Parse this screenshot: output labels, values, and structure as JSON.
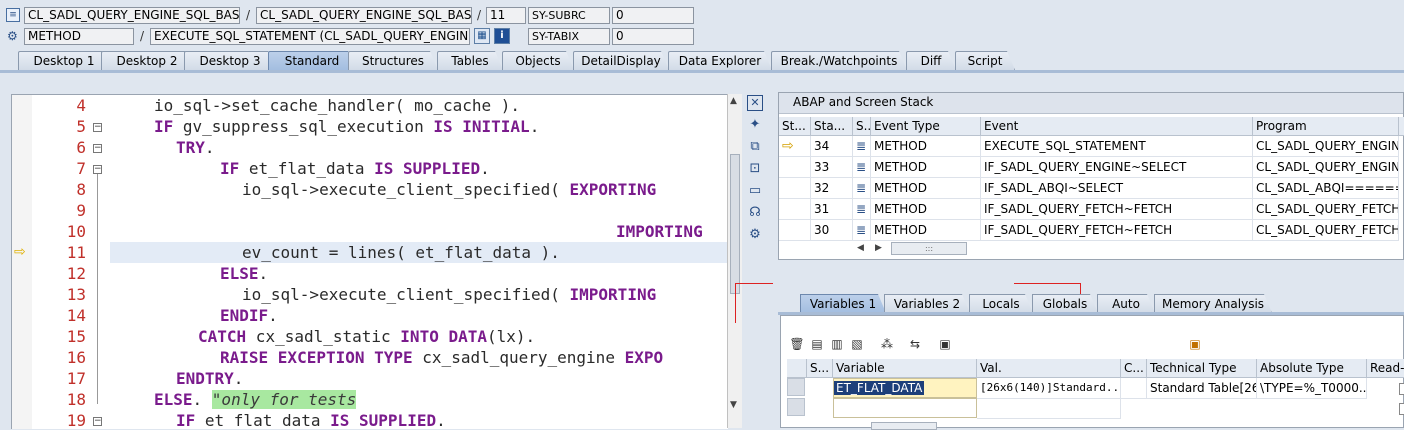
{
  "header": {
    "row1": {
      "class_name": "CL_SADL_QUERY_ENGINE_SQL_BASE...",
      "include_name": "CL_SADL_QUERY_ENGINE_SQL_BASE...",
      "line": "11",
      "sysvar": "SY-SUBRC",
      "sysval": "0"
    },
    "row2": {
      "proc_type": "METHOD",
      "proc_name": "EXECUTE_SQL_STATEMENT (CL_SADL_QUERY_ENGIN...",
      "sysvar": "SY-TABIX",
      "sysval": "0"
    },
    "separator": "/"
  },
  "tabs": [
    "Desktop 1",
    "Desktop 2",
    "Desktop 3",
    "Standard",
    "Structures",
    "Tables",
    "Objects",
    "DetailDisplay",
    "Data Explorer",
    "Break./Watchpoints",
    "Diff",
    "Script"
  ],
  "editor": {
    "lines": [
      {
        "num": "4"
      },
      {
        "num": "5"
      },
      {
        "num": "6"
      },
      {
        "num": "7"
      },
      {
        "num": "8"
      },
      {
        "num": "9"
      },
      {
        "num": "10"
      },
      {
        "num": "11"
      },
      {
        "num": "12"
      },
      {
        "num": "13"
      },
      {
        "num": "14"
      },
      {
        "num": "15"
      },
      {
        "num": "16"
      },
      {
        "num": "17"
      },
      {
        "num": "18"
      },
      {
        "num": "19"
      }
    ]
  },
  "stack": {
    "title": "ABAP and Screen Stack",
    "headers": [
      "St...",
      "Sta...",
      "S...",
      "Event Type",
      "Event",
      "Program"
    ],
    "rows": [
      {
        "level": "34",
        "type": "METHOD",
        "event": "EXECUTE_SQL_STATEMENT",
        "program": "CL_SADL_QUERY_ENGIN..."
      },
      {
        "level": "33",
        "type": "METHOD",
        "event": "IF_SADL_QUERY_ENGINE~SELECT",
        "program": "CL_SADL_QUERY_ENGIN..."
      },
      {
        "level": "32",
        "type": "METHOD",
        "event": "IF_SADL_ABQI~SELECT",
        "program": "CL_SADL_ABQI======..."
      },
      {
        "level": "31",
        "type": "METHOD",
        "event": "IF_SADL_QUERY_FETCH~FETCH",
        "program": "CL_SADL_QUERY_FETCH..."
      },
      {
        "level": "30",
        "type": "METHOD",
        "event": "IF_SADL_QUERY_FETCH~FETCH",
        "program": "CL_SADL_QUERY_FETCH..."
      }
    ],
    "scroll_mark": ":::"
  },
  "vars": {
    "tabs": [
      "Variables 1",
      "Variables 2",
      "Locals",
      "Globals",
      "Auto",
      "Memory Analysis"
    ],
    "headers": [
      "S...",
      "Variable",
      "Val.",
      "C...",
      "Technical Type",
      "Absolute Type",
      "Read-O"
    ],
    "rows": [
      {
        "variable": "ET_FLAT_DATA",
        "value": "[26x6(140)]Standard...",
        "tech_type": "Standard Table[26...",
        "abs_type": "\\TYPE=%_T0000..."
      }
    ]
  },
  "colors": {
    "bg": "#dfe6ef",
    "keyword": "#7a1b8c",
    "line_number": "#c0302a",
    "comment_bg": "#a8e8a0",
    "active_tab": "#a3bee0"
  }
}
